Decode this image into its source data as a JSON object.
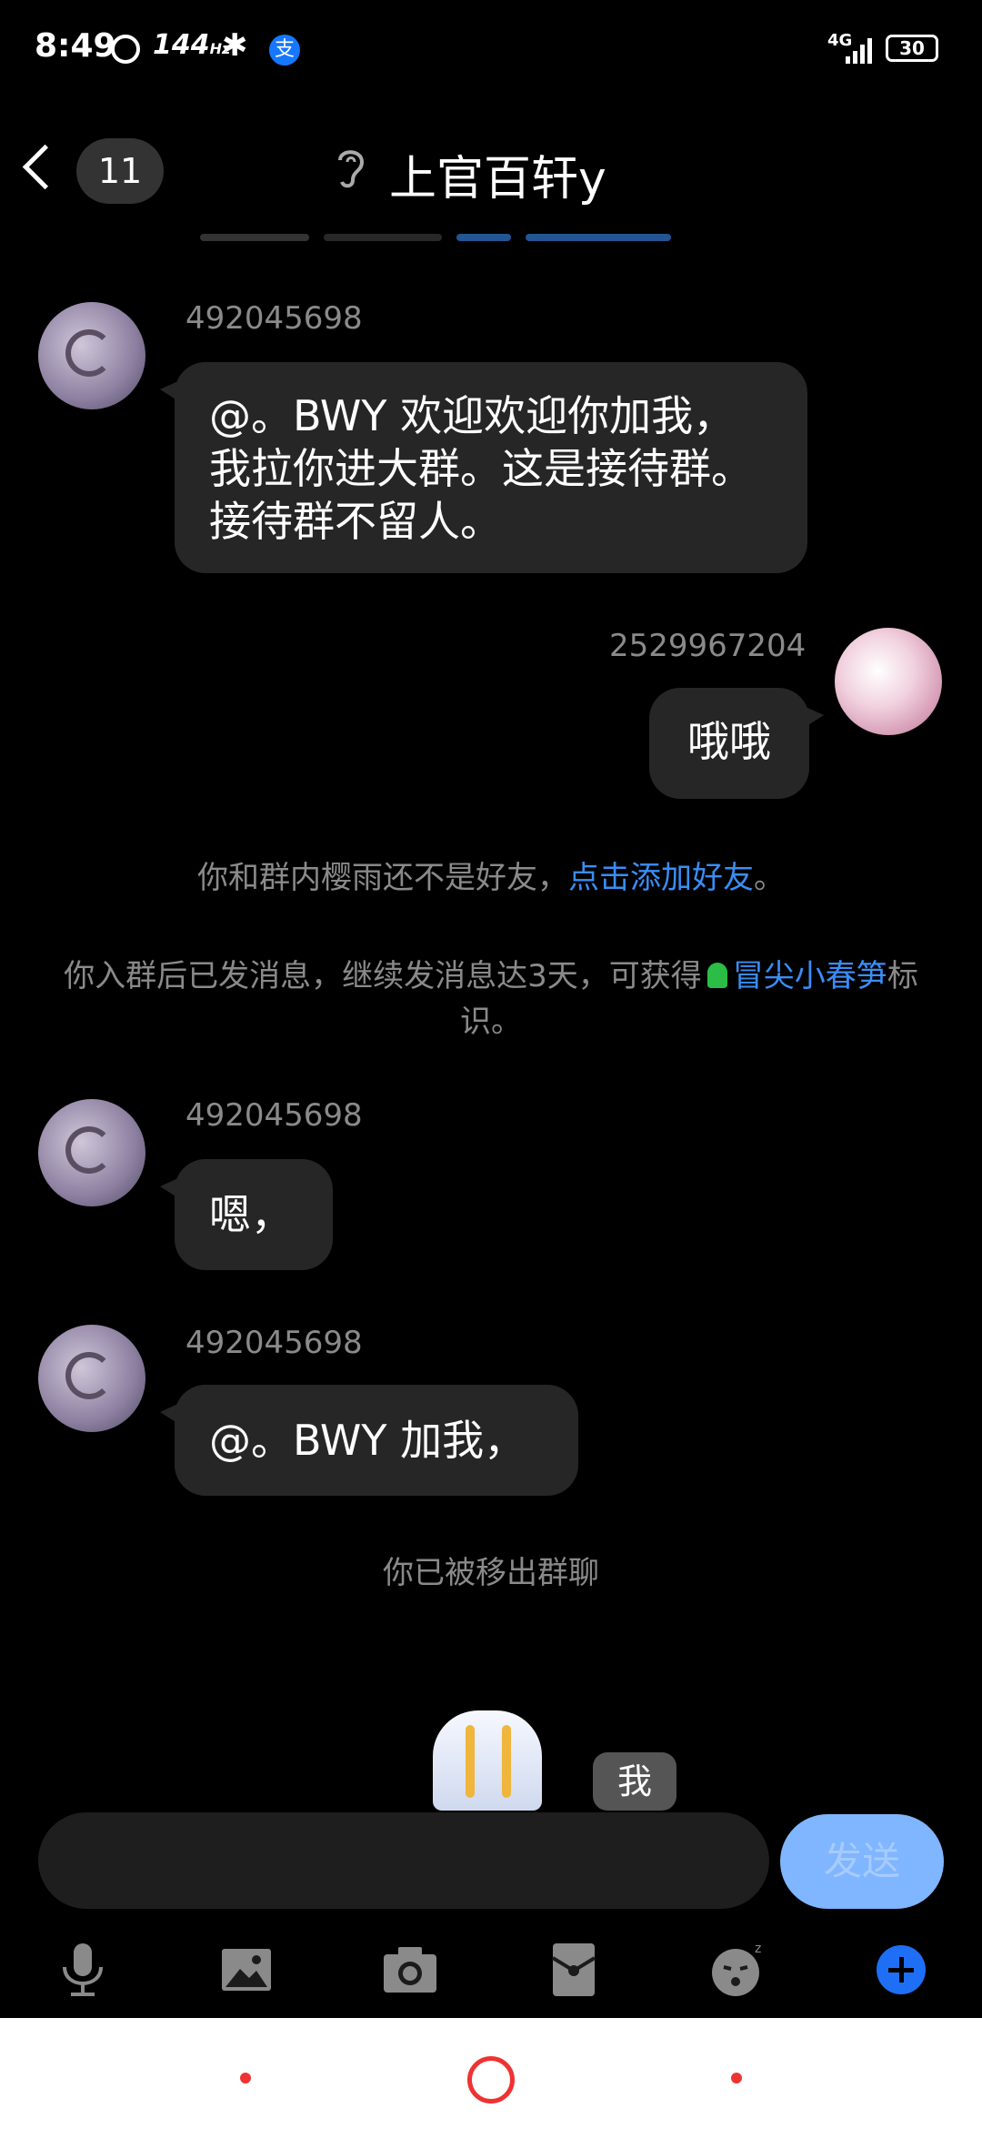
{
  "status_bar": {
    "time": "8:49",
    "refresh_rate": "144",
    "refresh_unit": "Hz",
    "network": "4G",
    "battery": "30"
  },
  "header": {
    "unread_count": "11",
    "title": "上官百轩y"
  },
  "messages": [
    {
      "sender": "492045698",
      "side": "left",
      "text": "@。BWY  欢迎欢迎你加我，我拉你进大群。这是接待群。接待群不留人。"
    },
    {
      "sender": "2529967204",
      "side": "right",
      "text": "哦哦"
    },
    {
      "sender": "492045698",
      "side": "left",
      "text": "嗯，"
    },
    {
      "sender": "492045698",
      "side": "left",
      "text": "@。BWY 加我，"
    }
  ],
  "system": {
    "friend_prefix": "你和群内樱雨还不是好友，",
    "friend_link": "点击添加好友",
    "friend_suffix": "。",
    "badge_prefix": "你入群后已发消息，继续发消息达3天，可获得",
    "badge_link": "冒尖小春笋",
    "badge_suffix": "标识。",
    "removed": "你已被移出群聊"
  },
  "sticker_hint": "我",
  "composer": {
    "value": "",
    "placeholder": "",
    "send_label": "发送"
  },
  "toolbar_icons": [
    "microphone-icon",
    "image-icon",
    "camera-icon",
    "red-packet-icon",
    "emoji-icon",
    "plus-icon"
  ],
  "colors": {
    "background": "#000000",
    "bubble": "#262626",
    "link": "#3a8ef6",
    "send": "#7fb6ff",
    "plus": "#1e6ff5"
  }
}
